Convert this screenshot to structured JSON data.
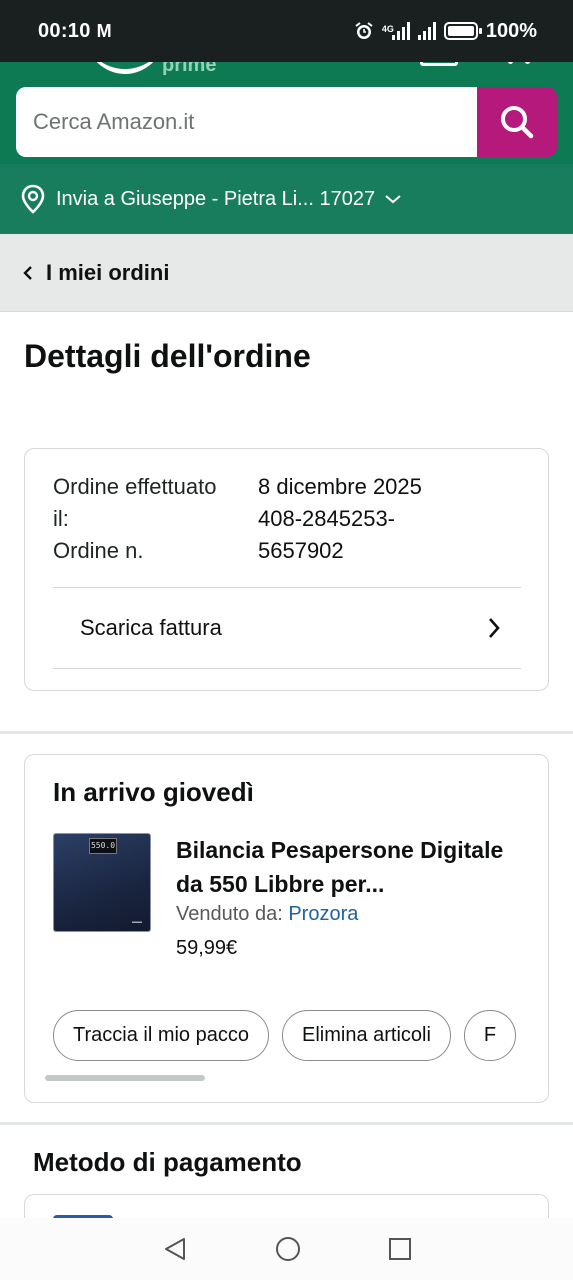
{
  "status_bar": {
    "time": "00:10",
    "notification": "M",
    "network": "4G",
    "battery": "100%"
  },
  "header": {
    "logo_subtext": "prime",
    "search_placeholder": "Cerca Amazon.it"
  },
  "delivery": {
    "text": "Invia a Giuseppe - Pietra Li... 17027"
  },
  "back_nav": {
    "label": "I miei ordini"
  },
  "page_title": "Dettagli dell'ordine",
  "order_summary": {
    "date_label": "Ordine effettuato il:",
    "date_value": "8 dicembre 2025",
    "number_label": "Ordine n.",
    "number_value": "408-2845253-5657902",
    "invoice_label": "Scarica fattura"
  },
  "shipment": {
    "status": "In arrivo giovedì",
    "product_title": "Bilancia Pesapersone Digitale da 550 Libbre per...",
    "seller_label": "Venduto da:",
    "seller_name": "Prozora",
    "price": "59,99€",
    "image_display": "550.0",
    "actions": [
      "Traccia il mio pacco",
      "Elimina articoli",
      "F"
    ]
  },
  "payment": {
    "title": "Metodo di pagamento"
  },
  "colors": {
    "header_green": "#0e7a53",
    "search_button": "#b5197b",
    "link_blue": "#2162a1"
  }
}
